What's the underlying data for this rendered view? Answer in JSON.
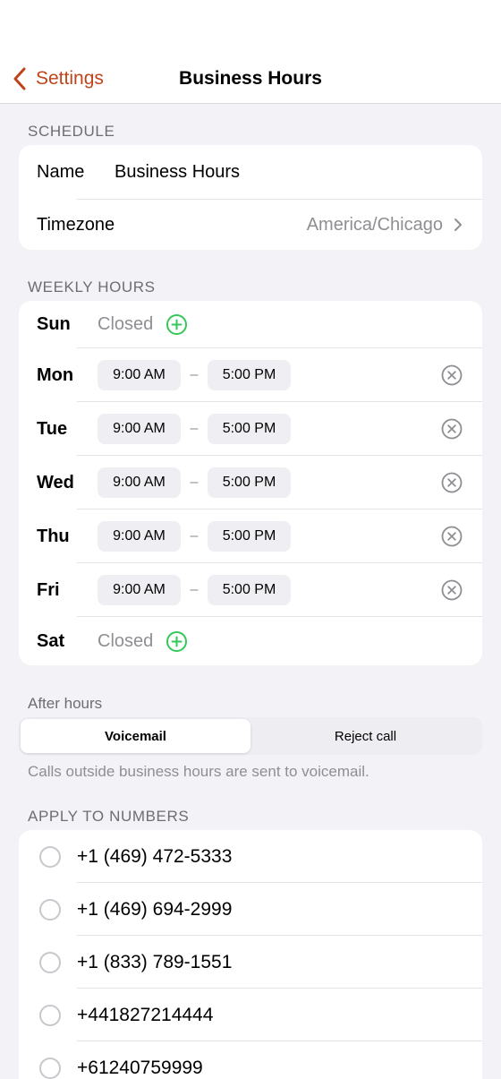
{
  "nav": {
    "back_label": "Settings",
    "title": "Business Hours"
  },
  "schedule": {
    "header": "SCHEDULE",
    "name_label": "Name",
    "name_value": "Business Hours",
    "timezone_label": "Timezone",
    "timezone_value": "America/Chicago"
  },
  "weekly": {
    "header": "WEEKLY HOURS",
    "separator": "–",
    "days": [
      {
        "day": "Sun",
        "closed": "Closed"
      },
      {
        "day": "Mon",
        "start": "9:00 AM",
        "end": "5:00 PM"
      },
      {
        "day": "Tue",
        "start": "9:00 AM",
        "end": "5:00 PM"
      },
      {
        "day": "Wed",
        "start": "9:00 AM",
        "end": "5:00 PM"
      },
      {
        "day": "Thu",
        "start": "9:00 AM",
        "end": "5:00 PM"
      },
      {
        "day": "Fri",
        "start": "9:00 AM",
        "end": "5:00 PM"
      },
      {
        "day": "Sat",
        "closed": "Closed"
      }
    ]
  },
  "after_hours": {
    "label": "After hours",
    "options": [
      "Voicemail",
      "Reject call"
    ],
    "selected": "Voicemail",
    "note": "Calls outside business hours are sent to voicemail."
  },
  "numbers": {
    "header": "APPLY TO NUMBERS",
    "items": [
      "+1 (469) 472-5333",
      "+1 (469) 694-2999",
      "+1 (833) 789-1551",
      "+441827214444",
      "+61240759999"
    ]
  },
  "colors": {
    "accent": "#c0441a",
    "add_green": "#34c759",
    "background": "#f2f2f7"
  }
}
